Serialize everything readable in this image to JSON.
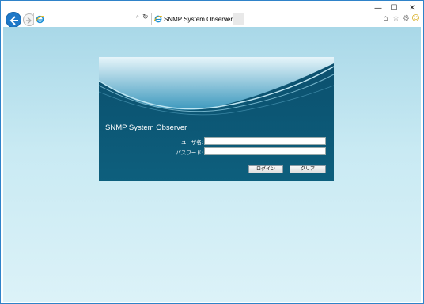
{
  "browser": {
    "address_value": "",
    "tab_title": "SNMP System Observer",
    "icons": {
      "back": "back-arrow-icon",
      "forward": "forward-arrow-icon",
      "ie": "ie-logo-icon",
      "search": "search-icon",
      "refresh": "refresh-icon",
      "close": "close-icon",
      "home": "home-icon",
      "favorites": "star-icon",
      "tools": "gear-icon",
      "smiley": "smiley-icon"
    },
    "window_controls": {
      "minimize": "—",
      "maximize": "☐",
      "close": "✕"
    }
  },
  "login": {
    "title": "SNMP System Observer",
    "username_label": "ユーザ名:",
    "password_label": "パスワード:",
    "username_value": "",
    "password_value": "",
    "login_button": "ログイン",
    "clear_button": "クリア"
  },
  "colors": {
    "accent": "#1e78c8",
    "panel_dark": "#0b4a66",
    "panel_light": "#5fb2cf",
    "page_bg": "#c9eaf3"
  }
}
